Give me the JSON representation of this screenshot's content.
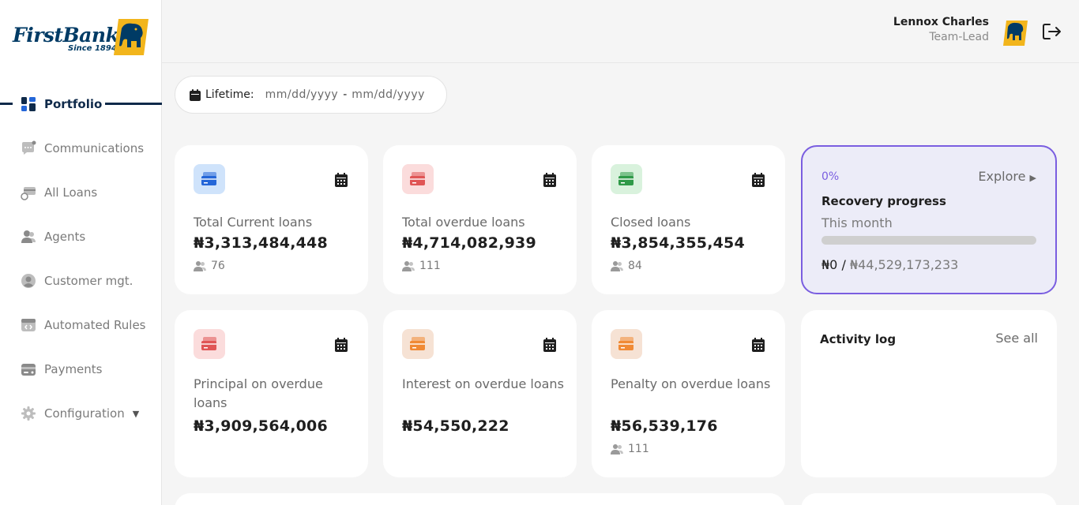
{
  "brand": {
    "name": "FirstBank",
    "since": "Since 1894"
  },
  "sidebar": {
    "items": [
      {
        "label": "Portfolio",
        "icon": "grid-icon",
        "active": true
      },
      {
        "label": "Communications",
        "icon": "chat-icon"
      },
      {
        "label": "All Loans",
        "icon": "loans-icon"
      },
      {
        "label": "Agents",
        "icon": "users-icon"
      },
      {
        "label": "Customer mgt.",
        "icon": "user-circle-icon"
      },
      {
        "label": "Automated Rules",
        "icon": "code-icon"
      },
      {
        "label": "Payments",
        "icon": "wallet-icon"
      },
      {
        "label": "Configuration",
        "icon": "gear-icon"
      }
    ]
  },
  "header": {
    "user_name": "Lennox Charles",
    "user_role": "Team-Lead"
  },
  "filter": {
    "label": "Lifetime:",
    "from_placeholder": "mm/dd/yyyy",
    "separator": "-",
    "to_placeholder": "mm/dd/yyyy"
  },
  "cards": [
    {
      "title": "Total Current loans",
      "amount": "₦3,313,484,448",
      "count": "76",
      "tile_color": "#cfe3fb",
      "icon_color": "#2466d8"
    },
    {
      "title": "Total overdue loans",
      "amount": "₦4,714,082,939",
      "count": "111",
      "tile_color": "#fbdcdc",
      "icon_color": "#e05555"
    },
    {
      "title": "Closed loans",
      "amount": "₦3,854,355,454",
      "count": "84",
      "tile_color": "#d9f2dd",
      "icon_color": "#2f9a48"
    },
    {
      "title": "Principal on overdue loans",
      "amount": "₦3,909,564,006",
      "count": "",
      "tile_color": "#fbdcdc",
      "icon_color": "#e05555"
    },
    {
      "title": "Interest on overdue loans",
      "amount": "₦54,550,222",
      "count": "",
      "tile_color": "#f6e2d4",
      "icon_color": "#f08a35"
    },
    {
      "title": "Penalty on overdue loans",
      "amount": "₦56,539,176",
      "count": "111",
      "tile_color": "#f6e2d4",
      "icon_color": "#f08a35"
    }
  ],
  "recovery": {
    "percent": "0%",
    "progress_fraction": 0,
    "explore": "Explore",
    "title": "Recovery progress",
    "subtitle": "This month",
    "recovered": "₦0",
    "slash": " / ",
    "total": "₦44,529,173,233"
  },
  "activity": {
    "title": "Activity log",
    "see_all": "See all"
  },
  "colors": {
    "accent": "#7a5ee0",
    "brand_navy": "#0f2a4a",
    "brand_gold": "#f2b51c"
  }
}
